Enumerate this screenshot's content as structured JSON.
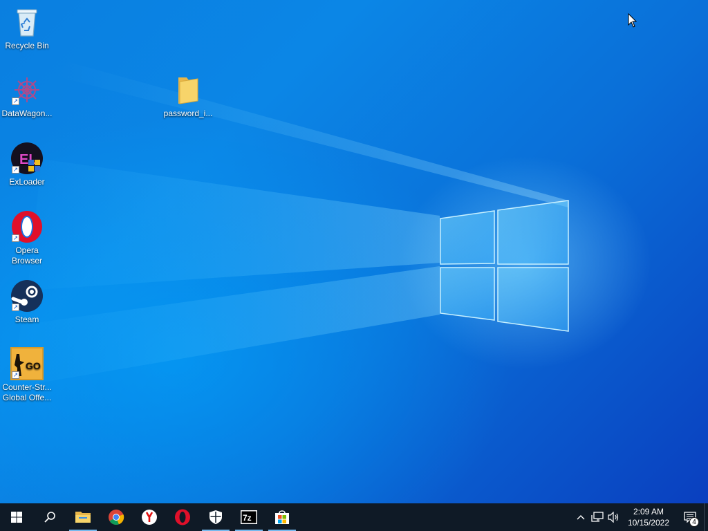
{
  "desktop": {
    "icons": [
      {
        "label": "Recycle Bin",
        "icon": "recycle-bin-icon"
      },
      {
        "label": "DataWagon...",
        "icon": "datawagon-icon"
      },
      {
        "label": "password_i...",
        "icon": "folder-icon"
      },
      {
        "label": "ExLoader",
        "icon": "exloader-icon"
      },
      {
        "label": "Opera\nBrowser",
        "icon": "opera-icon"
      },
      {
        "label": "Steam",
        "icon": "steam-icon"
      },
      {
        "label": "Counter-Str...\nGlobal Offe...",
        "icon": "csgo-icon"
      }
    ]
  },
  "taskbar": {
    "pinned": [
      {
        "name": "start-button",
        "icon": "windows-logo-icon"
      },
      {
        "name": "search-button",
        "icon": "search-icon"
      },
      {
        "name": "file-explorer-button",
        "icon": "folder-icon"
      },
      {
        "name": "chrome-button",
        "icon": "chrome-icon"
      },
      {
        "name": "yandex-button",
        "icon": "yandex-icon"
      },
      {
        "name": "opera-button",
        "icon": "opera-icon"
      },
      {
        "name": "security-button",
        "icon": "shield-icon"
      },
      {
        "name": "7zip-button",
        "icon": "7zip-icon"
      },
      {
        "name": "store-button",
        "icon": "store-icon"
      }
    ],
    "clock": {
      "time": "2:09 AM",
      "date": "10/15/2022"
    },
    "notification_count": "4"
  },
  "colors": {
    "taskbar": "#0f1a26",
    "accent": "#76b9ed",
    "desktop": "#0a7fe0"
  }
}
